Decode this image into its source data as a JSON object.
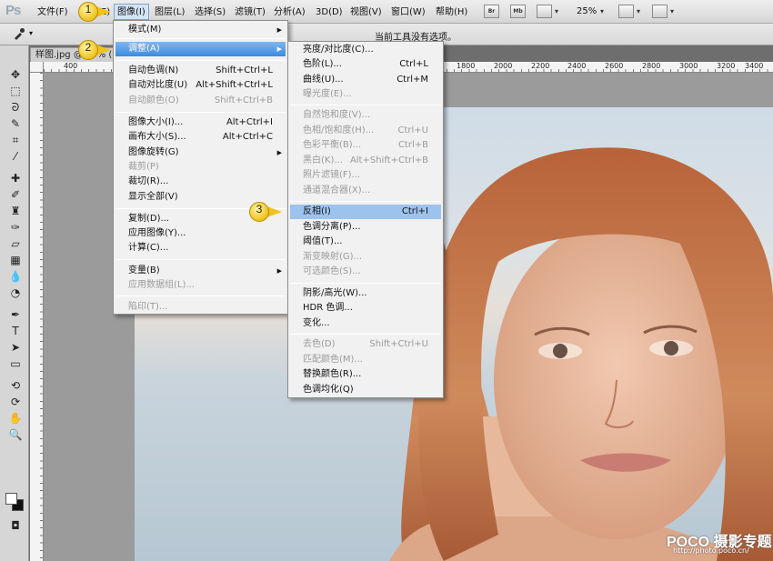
{
  "app": {
    "logo": "Ps"
  },
  "menubar": {
    "items": [
      "文件(F)",
      "编辑(E)",
      "图像(I)",
      "图层(L)",
      "选择(S)",
      "滤镜(T)",
      "分析(A)",
      "3D(D)",
      "视图(V)",
      "窗口(W)",
      "帮助(H)"
    ],
    "bridge_btn": "Br",
    "minibridge_btn": "Mb",
    "zoom": "25%"
  },
  "options_bar": {
    "hint": "当前工具没有选项。"
  },
  "document": {
    "tab_title": "样图.jpg @ 25% (曲",
    "ruler_ticks": [
      "400",
      "1800",
      "2000",
      "2200",
      "2400",
      "2600",
      "2800",
      "3000",
      "3200",
      "3400"
    ]
  },
  "image_menu": {
    "items": [
      {
        "label": "模式(M)",
        "shortcut": "",
        "submenu": true,
        "disabled": false
      },
      {
        "label": "调整(A)",
        "shortcut": "",
        "submenu": true,
        "disabled": false,
        "highlighted": true
      },
      {
        "label": "自动色调(N)",
        "shortcut": "Shift+Ctrl+L",
        "disabled": false
      },
      {
        "label": "自动对比度(U)",
        "shortcut": "Alt+Shift+Ctrl+L",
        "disabled": false
      },
      {
        "label": "自动颜色(O)",
        "shortcut": "Shift+Ctrl+B",
        "disabled": true
      },
      {
        "label": "图像大小(I)...",
        "shortcut": "Alt+Ctrl+I",
        "disabled": false
      },
      {
        "label": "画布大小(S)...",
        "shortcut": "Alt+Ctrl+C",
        "disabled": false
      },
      {
        "label": "图像旋转(G)",
        "shortcut": "",
        "submenu": true,
        "disabled": false
      },
      {
        "label": "裁剪(P)",
        "shortcut": "",
        "disabled": true
      },
      {
        "label": "裁切(R)...",
        "shortcut": "",
        "disabled": false
      },
      {
        "label": "显示全部(V)",
        "shortcut": "",
        "disabled": false
      },
      {
        "label": "复制(D)...",
        "shortcut": "",
        "disabled": false
      },
      {
        "label": "应用图像(Y)...",
        "shortcut": "",
        "disabled": false
      },
      {
        "label": "计算(C)...",
        "shortcut": "",
        "disabled": false
      },
      {
        "label": "变量(B)",
        "shortcut": "",
        "submenu": true,
        "disabled": false
      },
      {
        "label": "应用数据组(L)...",
        "shortcut": "",
        "disabled": true
      },
      {
        "label": "陷印(T)...",
        "shortcut": "",
        "disabled": true
      }
    ]
  },
  "adjust_menu": {
    "items": [
      {
        "label": "亮度/对比度(C)...",
        "shortcut": "",
        "disabled": false
      },
      {
        "label": "色阶(L)...",
        "shortcut": "Ctrl+L",
        "disabled": false
      },
      {
        "label": "曲线(U)...",
        "shortcut": "Ctrl+M",
        "disabled": false
      },
      {
        "label": "曝光度(E)...",
        "shortcut": "",
        "disabled": true
      },
      {
        "label": "自然饱和度(V)...",
        "shortcut": "",
        "disabled": true
      },
      {
        "label": "色相/饱和度(H)...",
        "shortcut": "Ctrl+U",
        "disabled": true
      },
      {
        "label": "色彩平衡(B)...",
        "shortcut": "Ctrl+B",
        "disabled": true
      },
      {
        "label": "黑白(K)...",
        "shortcut": "Alt+Shift+Ctrl+B",
        "disabled": true
      },
      {
        "label": "照片滤镜(F)...",
        "shortcut": "",
        "disabled": true
      },
      {
        "label": "通道混合器(X)...",
        "shortcut": "",
        "disabled": true
      },
      {
        "label": "反相(I)",
        "shortcut": "Ctrl+I",
        "disabled": false,
        "highlighted": true
      },
      {
        "label": "色调分离(P)...",
        "shortcut": "",
        "disabled": false
      },
      {
        "label": "阈值(T)...",
        "shortcut": "",
        "disabled": false
      },
      {
        "label": "渐变映射(G)...",
        "shortcut": "",
        "disabled": true
      },
      {
        "label": "可选颜色(S)...",
        "shortcut": "",
        "disabled": true
      },
      {
        "label": "阴影/高光(W)...",
        "shortcut": "",
        "disabled": false
      },
      {
        "label": "HDR 色调...",
        "shortcut": "",
        "disabled": false
      },
      {
        "label": "变化...",
        "shortcut": "",
        "disabled": false
      },
      {
        "label": "去色(D)",
        "shortcut": "Shift+Ctrl+U",
        "disabled": true
      },
      {
        "label": "匹配颜色(M)...",
        "shortcut": "",
        "disabled": true
      },
      {
        "label": "替换颜色(R)...",
        "shortcut": "",
        "disabled": false
      },
      {
        "label": "色调均化(Q)",
        "shortcut": "",
        "disabled": false
      }
    ]
  },
  "callouts": [
    "1",
    "2",
    "3"
  ],
  "watermark": {
    "brand": "POCO 摄影专题",
    "url": "http://photo.poco.cn/"
  },
  "colors": {
    "highlight": "#3b8be0",
    "callout": "#f0c21c",
    "menu_bg": "#f1f1f1"
  }
}
